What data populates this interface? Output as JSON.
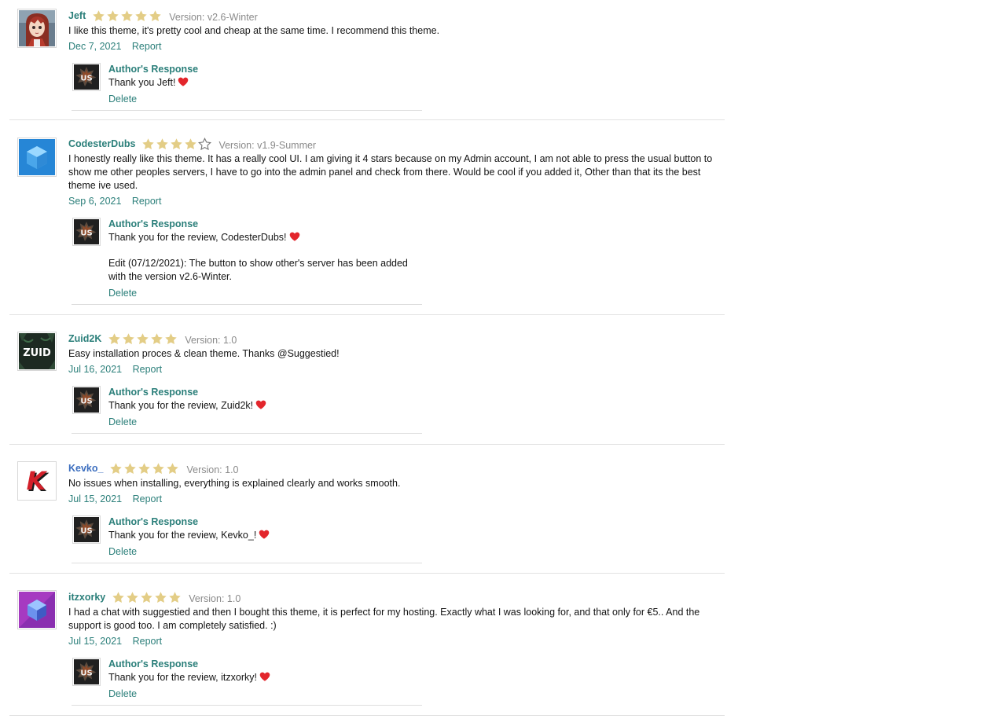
{
  "reviews": [
    {
      "username": "Jeft",
      "rating": 5,
      "version": "Version: v2.6-Winter",
      "text": "I like this theme, it's pretty cool and cheap at the same time. I recommend this theme.",
      "date": "Dec 7, 2021",
      "report_label": "Report",
      "response": {
        "title": "Author's Response",
        "text": "Thank you Jeft!",
        "delete_label": "Delete"
      }
    },
    {
      "username": "CodesterDubs",
      "rating": 4,
      "version": "Version: v1.9-Summer",
      "text": "I honestly really like this theme. It has a really cool UI. I am giving it 4 stars because on my Admin account, I am not able to press the usual button to show me other peoples servers, I have to go into the admin panel and check from there. Would be cool if you added it, Other than that its the best theme ive used.",
      "date": "Sep 6, 2021",
      "report_label": "Report",
      "response": {
        "title": "Author's Response",
        "text": "Thank you for the review, CodesterDubs!",
        "edit_text": "Edit (07/12/2021): The button to show other's server has been added with the version v2.6-Winter.",
        "delete_label": "Delete"
      }
    },
    {
      "username": "Zuid2K",
      "rating": 5,
      "version": "Version: 1.0",
      "text": "Easy installation proces & clean theme. Thanks @Suggestied!",
      "date": "Jul 16, 2021",
      "report_label": "Report",
      "response": {
        "title": "Author's Response",
        "text": "Thank you for the review, Zuid2k!",
        "delete_label": "Delete"
      }
    },
    {
      "username": "Kevko_",
      "rating": 5,
      "version": "Version: 1.0",
      "text": "No issues when installing, everything is explained clearly and works smooth.",
      "date": "Jul 15, 2021",
      "report_label": "Report",
      "response": {
        "title": "Author's Response",
        "text": "Thank you for the review, Kevko_!",
        "delete_label": "Delete"
      }
    },
    {
      "username": "itzxorky",
      "rating": 5,
      "version": "Version: 1.0",
      "text": "I had a chat with suggestied and then I bought this theme, it is perfect for my hosting. Exactly what I was looking for, and that only for €5.. And the support is good too. I am completely satisfied. :)",
      "date": "Jul 15, 2021",
      "report_label": "Report",
      "response": {
        "title": "Author's Response",
        "text": "Thank you for the review, itzxorky!",
        "delete_label": "Delete"
      }
    }
  ],
  "avatars": {
    "zuid_logo_text": "ZUID",
    "kevko_logo_text": "K",
    "author_logo_text": "US"
  },
  "icons": {
    "star_filled": "star-filled-icon",
    "star_empty": "star-empty-icon",
    "heart": "heart-icon"
  },
  "colors": {
    "link_teal": "#2b7f7a",
    "link_blue": "#3d6fbf",
    "star_gold": "#e3cd86",
    "heart_red": "#e3262c",
    "meta_gray": "#8a8a8a"
  }
}
